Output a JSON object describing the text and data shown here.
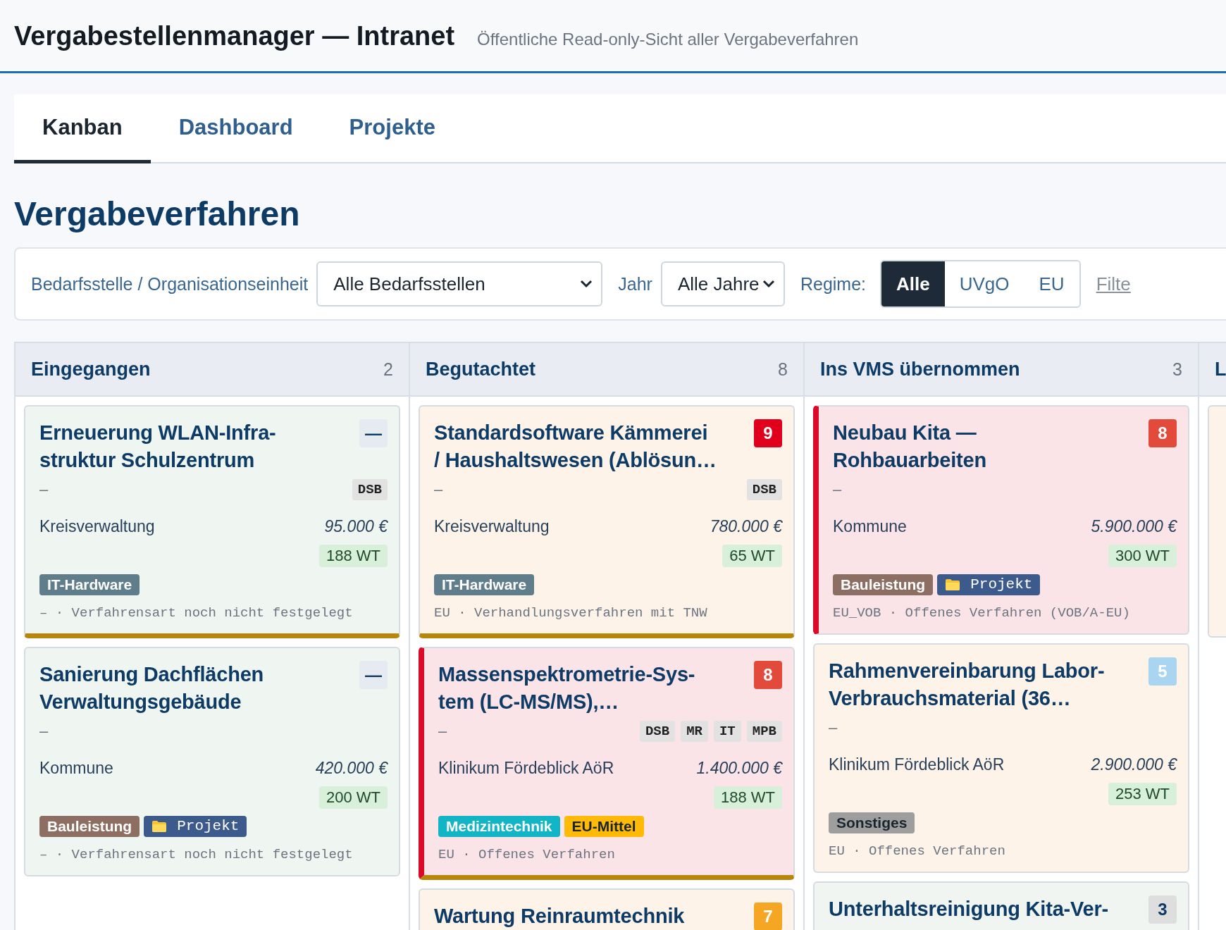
{
  "header": {
    "title": "Vergabestellenmanager — Intranet",
    "subtitle": "Öffentliche Read-only-Sicht aller Vergabeverfahren"
  },
  "tabs": [
    {
      "label": "Kanban",
      "selected": true
    },
    {
      "label": "Dashboard",
      "selected": false
    },
    {
      "label": "Projekte",
      "selected": false
    }
  ],
  "heading": "Vergabeverfahren",
  "filters": {
    "org_label": "Bedarfsstelle / Organisationseinheit",
    "org_value": "Alle Bedarfsstellen",
    "year_label": "Jahr",
    "year_value": "Alle Jahre",
    "regime_label": "Regime:",
    "regime_options": [
      {
        "label": "Alle",
        "selected": true
      },
      {
        "label": "UVgO",
        "selected": false
      },
      {
        "label": "EU",
        "selected": false
      }
    ],
    "link": "Filte"
  },
  "columns": [
    {
      "title": "Eingegangen",
      "count": "2",
      "cards": [
        {
          "title": "Erneuerung WLAN-Infra-struktur Schulzentrum",
          "badge": {
            "text": "—",
            "color": "#e6eaf1"
          },
          "dash": "–",
          "roles": [
            "DSB"
          ],
          "org": "Kreisverwaltung",
          "amount": "95.000 €",
          "days": "188 WT",
          "tags": [
            {
              "label": "IT-Hardware",
              "kind": "category",
              "color": "#607d8b"
            }
          ],
          "procedure": "– · Verfahrensart noch nicht festgelegt",
          "color": "#eff5f1",
          "urgent": false,
          "deadline_bar": true
        },
        {
          "title": "Sanierung Dachflächen Verwaltungsgebäude",
          "badge": {
            "text": "—",
            "color": "#e6eaf1"
          },
          "dash": "–",
          "org": "Kommune",
          "amount": "420.000 €",
          "days": "200 WT",
          "tags": [
            {
              "label": "Bauleistung",
              "kind": "category",
              "color": "#8d6e63"
            },
            {
              "label": "Projekt",
              "kind": "project",
              "color": "#3c5a8c"
            }
          ],
          "procedure": "– · Verfahrensart noch nicht festgelegt",
          "color": "#eff5f1",
          "urgent": false,
          "deadline_bar": false
        }
      ]
    },
    {
      "title": "Begutachtet",
      "count": "8",
      "cards": [
        {
          "title": "Standardsoftware Kämmerei / Haushaltswesen (Ablösun…",
          "badge": {
            "text": "9",
            "color": "#e0001b"
          },
          "dash": "–",
          "roles": [
            "DSB"
          ],
          "org": "Kreisverwaltung",
          "amount": "780.000 €",
          "days": "65 WT",
          "tags": [
            {
              "label": "IT-Hardware",
              "kind": "category",
              "color": "#607d8b"
            }
          ],
          "procedure": "EU · Verhandlungsverfahren mit TNW",
          "color": "#fdf3e8",
          "urgent": false,
          "deadline_bar": true
        },
        {
          "title": "Massenspektrometrie-Sys-tem (LC-MS/MS),…",
          "badge": {
            "text": "8",
            "color": "#e24b3b"
          },
          "dash": "–",
          "roles": [
            "DSB",
            "MR",
            "IT",
            "MPB"
          ],
          "org": "Klinikum Fördeblick AöR",
          "amount": "1.400.000 €",
          "days": "188 WT",
          "tags": [
            {
              "label": "Medizintechnik",
              "kind": "category",
              "color": "#12b5c6"
            },
            {
              "label": "EU-Mittel",
              "kind": "category",
              "color": "#ffba08"
            }
          ],
          "procedure": "EU · Offenes Verfahren",
          "color": "#fbe4e7",
          "urgent": true,
          "deadline_bar": true
        },
        {
          "title": "Wartung Reinraumtechnik",
          "badge": {
            "text": "7",
            "color": "#f5a623"
          },
          "color": "#fdf3e8",
          "urgent": false
        }
      ]
    },
    {
      "title": "Ins VMS übernommen",
      "count": "3",
      "cards": [
        {
          "title": "Neubau Kita — Rohbauarbeiten",
          "badge": {
            "text": "8",
            "color": "#e24b3b"
          },
          "dash": "–",
          "org": "Kommune",
          "amount": "5.900.000 €",
          "days": "300 WT",
          "tags": [
            {
              "label": "Bauleistung",
              "kind": "category",
              "color": "#8d6e63"
            },
            {
              "label": "Projekt",
              "kind": "project",
              "color": "#3c5a8c"
            }
          ],
          "procedure": "EU_VOB · Offenes Verfahren (VOB/A-EU)",
          "color": "#fbe4e7",
          "urgent": true,
          "deadline_bar": false
        },
        {
          "title": "Rahmenvereinbarung Labor-Verbrauchsmaterial (36…",
          "badge": {
            "text": "5",
            "color": "#a9d5f0"
          },
          "dash": "–",
          "org": "Klinikum Fördeblick AöR",
          "amount": "2.900.000 €",
          "days": "253 WT",
          "tags": [
            {
              "label": "Sonstiges",
              "kind": "category",
              "color": "#9e9e9e"
            }
          ],
          "procedure": "EU · Offenes Verfahren",
          "color": "#fdf3e8",
          "urgent": false,
          "deadline_bar": false
        },
        {
          "title": "Unterhaltsreinigung Kita-Ver-",
          "badge": {
            "text": "3",
            "color": "#dedede"
          },
          "color": "#f0f5f2",
          "urgent": false
        }
      ]
    },
    {
      "title": "L",
      "cards": [
        {
          "color": "#fdf3e8",
          "urgent": false,
          "deadline_bar": false
        }
      ]
    }
  ]
}
